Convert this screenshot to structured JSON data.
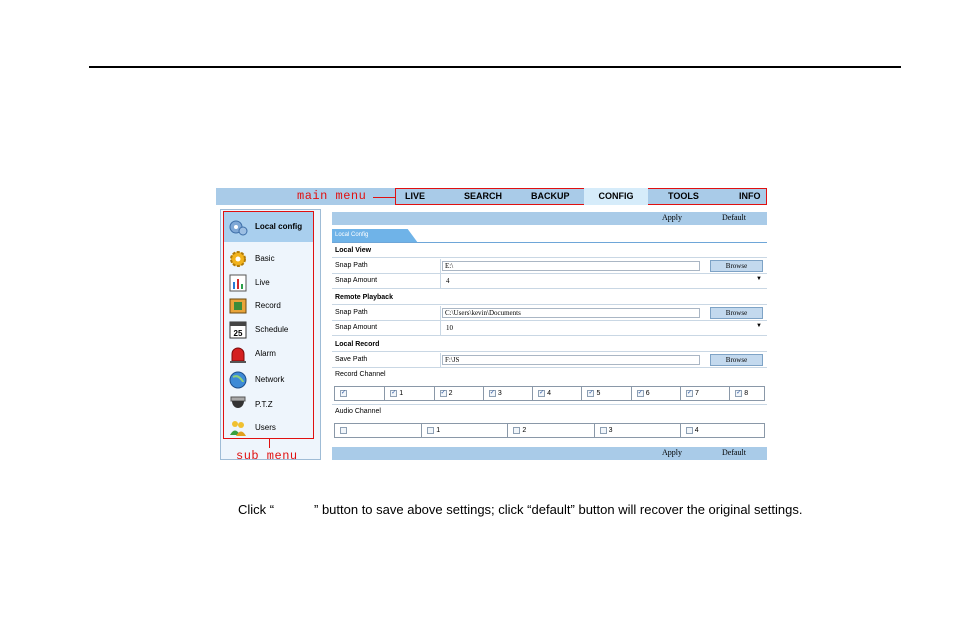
{
  "main_menu_annotation": "main menu",
  "sub_menu_annotation": "sub menu",
  "main_menu": {
    "items": [
      "LIVE",
      "SEARCH",
      "BACKUP",
      "CONFIG",
      "TOOLS",
      "INFO"
    ],
    "active": "CONFIG"
  },
  "sidebar": {
    "header": "Local config",
    "items": [
      {
        "label": "Basic",
        "icon": "gear-icon"
      },
      {
        "label": "Live",
        "icon": "bar-chart-icon"
      },
      {
        "label": "Record",
        "icon": "film-icon"
      },
      {
        "label": "Schedule",
        "icon": "calendar-icon"
      },
      {
        "label": "Alarm",
        "icon": "alarm-siren-icon"
      },
      {
        "label": "Network",
        "icon": "globe-icon"
      },
      {
        "label": "P.T.Z",
        "icon": "dome-camera-icon"
      },
      {
        "label": "Users",
        "icon": "users-icon"
      }
    ]
  },
  "toolbar": {
    "apply_label": "Apply",
    "default_label": "Default"
  },
  "tab": "Local Config",
  "local_view": {
    "title": "Local View",
    "snap_path_label": "Snap Path",
    "snap_path_value": "E:\\",
    "snap_amount_label": "Snap Amount",
    "snap_amount_value": "4"
  },
  "remote_playback": {
    "title": "Remote Playback",
    "snap_path_label": "Snap Path",
    "snap_path_value": "C:\\Users\\kevin\\Documents",
    "snap_amount_label": "Snap Amount",
    "snap_amount_value": "10"
  },
  "local_record": {
    "title": "Local Record",
    "save_path_label": "Save Path",
    "save_path_value": "F:\\JS",
    "record_channel_label": "Record Channel",
    "record_channels": [
      "",
      "1",
      "2",
      "3",
      "4",
      "5",
      "6",
      "7",
      "8"
    ],
    "record_checked": true,
    "audio_channel_label": "Audio Channel",
    "audio_channels": [
      "",
      "1",
      "2",
      "3",
      "4"
    ],
    "audio_checked": false
  },
  "browse_label": "Browse",
  "caption": {
    "prefix": "Click “",
    "suffix": "” button to save above settings; click “default” button will recover the original settings."
  },
  "colors": {
    "annotation": "#e01010",
    "menu_bar": "#a9cbe8",
    "active_tab": "#6fb3e8"
  }
}
